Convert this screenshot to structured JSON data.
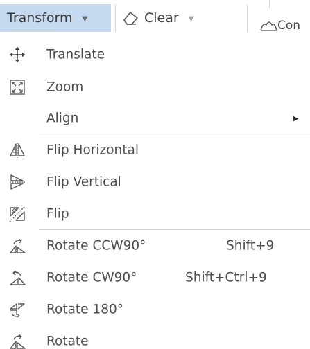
{
  "toolbar": {
    "transform_label": "Transform",
    "clear_label": "Clear",
    "con_label": "Con"
  },
  "menu": {
    "translate": {
      "label": "Translate",
      "icon": "move-arrows-icon"
    },
    "zoom": {
      "label": "Zoom",
      "icon": "zoom-fit-icon"
    },
    "align": {
      "label": "Align"
    },
    "flip_horizontal": {
      "label": "Flip Horizontal",
      "icon": "flip-horizontal-icon"
    },
    "flip_vertical": {
      "label": "Flip Vertical",
      "icon": "flip-vertical-icon"
    },
    "flip": {
      "label": "Flip",
      "icon": "flip-diagonal-icon"
    },
    "rotate_ccw90": {
      "label": "Rotate CCW90°",
      "shortcut": "Shift+9",
      "icon": "rotate-ccw-icon"
    },
    "rotate_cw90": {
      "label": "Rotate CW90°",
      "shortcut": "Shift+Ctrl+9",
      "icon": "rotate-cw-icon"
    },
    "rotate_180": {
      "label": "Rotate 180°",
      "icon": "rotate-180-icon"
    },
    "rotate": {
      "label": "Rotate",
      "icon": "rotate-icon"
    }
  },
  "colors": {
    "active_button_bg": "#c5daf1",
    "separator": "#d2d2d2",
    "text": "#4f4f4f"
  }
}
